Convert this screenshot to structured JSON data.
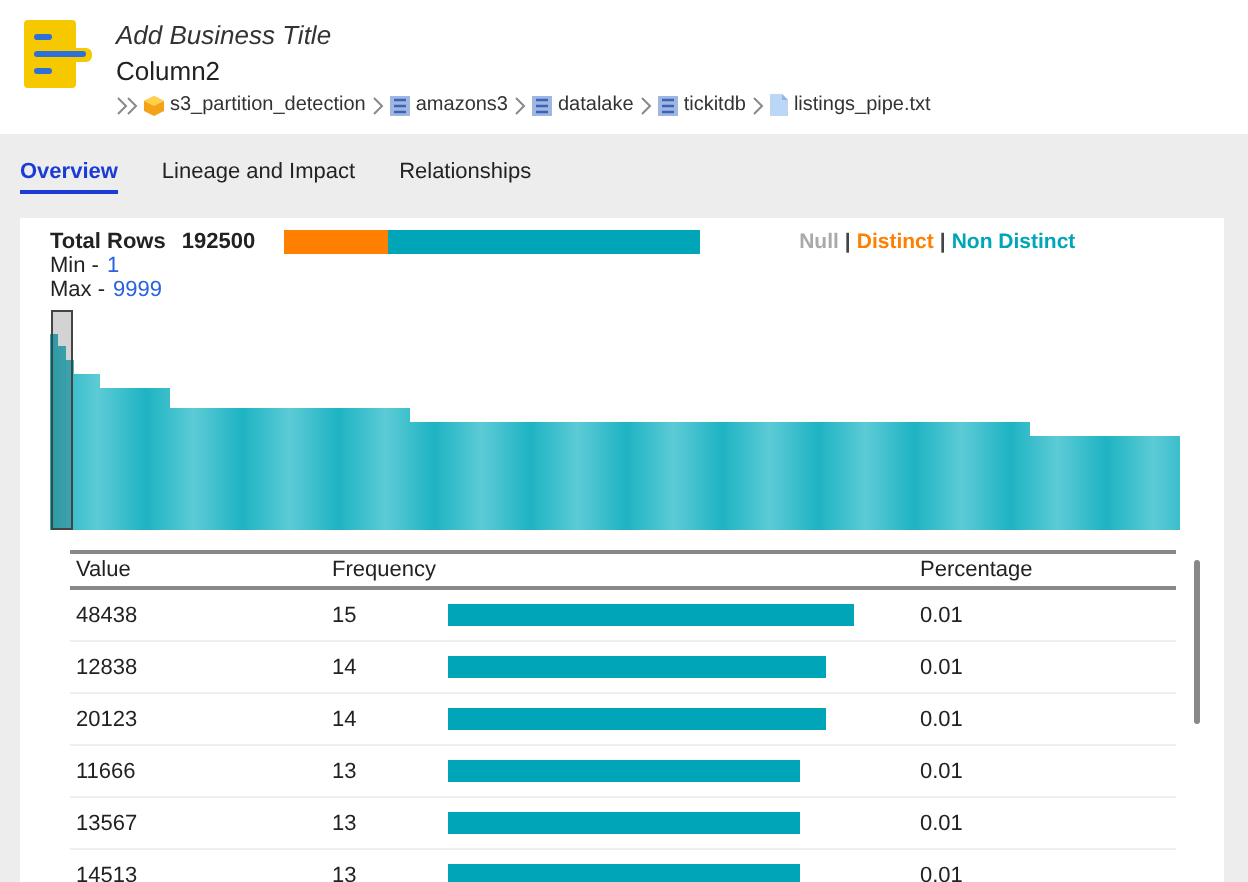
{
  "header": {
    "business_title": "Add Business Title",
    "name": "Column2",
    "breadcrumb": [
      {
        "label": "s3_partition_detection",
        "kind": "box"
      },
      {
        "label": "amazons3",
        "kind": "schema"
      },
      {
        "label": "datalake",
        "kind": "schema"
      },
      {
        "label": "tickitdb",
        "kind": "schema"
      },
      {
        "label": "listings_pipe.txt",
        "kind": "file"
      }
    ]
  },
  "tabs": [
    {
      "label": "Overview",
      "selected": true
    },
    {
      "label": "Lineage and Impact",
      "selected": false
    },
    {
      "label": "Relationships",
      "selected": false
    }
  ],
  "summary": {
    "total_label": "Total Rows",
    "total": "192500",
    "distinct_share": {
      "level": 0.25
    },
    "legend": [
      {
        "label": "Null",
        "kind": "null"
      },
      {
        "label": "|",
        "kind": "separator"
      },
      {
        "label": "Distinct",
        "kind": "distinct"
      },
      {
        "label": "|",
        "kind": "separator"
      },
      {
        "label": "Non Distinct",
        "kind": "non_distinct"
      }
    ],
    "min_label": "Min -",
    "min": "1",
    "max_label": "Max -",
    "max": "9999"
  },
  "table": {
    "columns": [
      "Value",
      "Frequency",
      "Percentage"
    ],
    "rows": [
      {
        "value": "48438",
        "frequency": "15",
        "percentage": "0.01"
      },
      {
        "value": "12838",
        "frequency": "14",
        "percentage": "0.01"
      },
      {
        "value": "20123",
        "frequency": "14",
        "percentage": "0.01"
      },
      {
        "value": "11666",
        "frequency": "13",
        "percentage": "0.01"
      },
      {
        "value": "13567",
        "frequency": "13",
        "percentage": "0.01"
      },
      {
        "value": "14513",
        "frequency": "13",
        "percentage": "0.01"
      }
    ]
  }
}
